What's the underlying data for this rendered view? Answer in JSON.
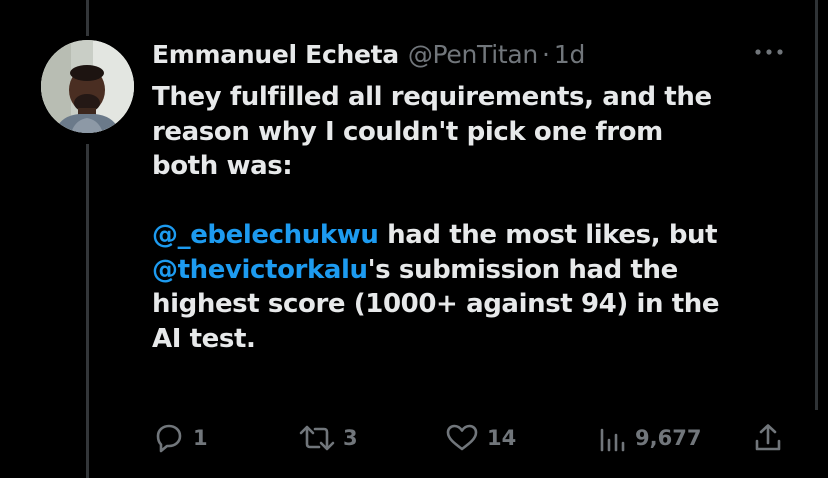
{
  "tweet": {
    "author_name": "Emmanuel Echeta",
    "handle": "@PenTitan",
    "separator": "·",
    "timestamp": "1d",
    "body": {
      "line1": "They fulfilled all requirements, and the",
      "line2": "reason why I couldn't pick one from",
      "line3": "both was:",
      "mention1": "@_ebelechukwu",
      "line4_rest": " had the most likes, but",
      "mention2": "@thevictorkalu",
      "line5_rest": "'s submission had the",
      "line6": "highest score (1000+ against 94) in the",
      "line7": "AI test."
    },
    "actions": {
      "replies": "1",
      "retweets": "3",
      "likes": "14",
      "views": "9,677"
    }
  },
  "colors": {
    "background": "#000000",
    "text": "#e7e9ea",
    "secondary": "#71767b",
    "mention": "#1d9bf0"
  },
  "icons": [
    "more-icon",
    "reply-icon",
    "retweet-icon",
    "like-icon",
    "views-icon",
    "share-icon"
  ]
}
